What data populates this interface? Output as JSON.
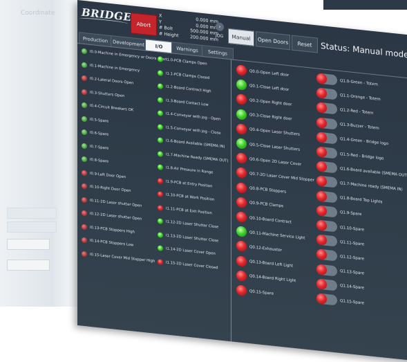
{
  "background": {
    "ghost_label": "Coordinate"
  },
  "header": {
    "logo": "BRIDGE",
    "abort": "Abort",
    "coords": [
      {
        "label": "X",
        "value": "0.000 mm"
      },
      {
        "label": "Y",
        "value": "0.000 mm"
      },
      {
        "label": "# Bolt",
        "value": "500.000 mm"
      },
      {
        "label": "# Height",
        "value": "200.000 mm"
      }
    ],
    "jog_arrow": "›",
    "jog_label": "JOG",
    "manual": "Manual",
    "open_doors": "Open Doors",
    "reset": "Reset",
    "status": "Status: Manual mode"
  },
  "tabs": [
    "Production",
    "Development",
    "I/O",
    "Warnings",
    "Settings"
  ],
  "active_tab": "I/O",
  "inputs_a": [
    {
      "label": "I0.0-Machine in Emergency or Doors open",
      "on": true
    },
    {
      "label": "I0.1-Machine in Emergency",
      "on": true
    },
    {
      "label": "I0.2-Lateral Doors Open",
      "on": false
    },
    {
      "label": "I0.3-Shutters Open",
      "on": false
    },
    {
      "label": "I0.4-Circuit Breakers OK",
      "on": true
    },
    {
      "label": "I0.5-Spare",
      "on": true
    },
    {
      "label": "I0.6-Spare",
      "on": true
    },
    {
      "label": "I0.7-Spare",
      "on": true
    },
    {
      "label": "I0.8-Spare",
      "on": true
    },
    {
      "label": "I0.9-Left Door Open",
      "on": false
    },
    {
      "label": "I0.10-Right Door Open",
      "on": false
    },
    {
      "label": "I0.11-2D Laser shutter Open",
      "on": false
    },
    {
      "label": "I0.12-2D Laser shutter Open",
      "on": false
    },
    {
      "label": "I0.13-PCB Stoppers High",
      "on": false
    },
    {
      "label": "I0.14-PCB Stoppers Low",
      "on": false
    },
    {
      "label": "I0.15-Laser Cover Mid Stopper High",
      "on": false
    }
  ],
  "inputs_b": [
    {
      "label": "I1.0-PCB Clamps Open",
      "on": true
    },
    {
      "label": "I1.1-PCB Clamps Closed",
      "on": true
    },
    {
      "label": "I1.2-Board Contract High",
      "on": true
    },
    {
      "label": "I1.3-Board Contact Low",
      "on": true
    },
    {
      "label": "I1.4-Conveyor with jog - Open",
      "on": true
    },
    {
      "label": "I1.5-Conveyor with jog - Close",
      "on": true
    },
    {
      "label": "I1.6-Board Available (SMEMA IN)",
      "on": true
    },
    {
      "label": "I1.7-Machine Ready (SMEMA OUT)",
      "on": true
    },
    {
      "label": "I1.8-Air Pressure in Range",
      "on": true
    },
    {
      "label": "I1.9-PCB at Entry Position",
      "on": false
    },
    {
      "label": "I1.10-PCB at Work Position",
      "on": false
    },
    {
      "label": "I1.11-PCB at Exit Position",
      "on": false
    },
    {
      "label": "I1.12-2D Laser Shutter Close",
      "on": true
    },
    {
      "label": "I1.13-2D Laser Shutter Close",
      "on": true
    },
    {
      "label": "I1.14-2D Laser Cover Open",
      "on": true
    },
    {
      "label": "I1.15-2D Laser Cover Closed",
      "on": false
    }
  ],
  "outputs_a": [
    {
      "label": "Q0.0-Open Left door",
      "on": false
    },
    {
      "label": "Q0.1-Close Left door",
      "on": true
    },
    {
      "label": "Q0.2-Open Right door",
      "on": false
    },
    {
      "label": "Q0.3-Close Right door",
      "on": true
    },
    {
      "label": "Q0.4-Open Laser Shutters",
      "on": false
    },
    {
      "label": "Q0.5-Close Laser Shutters",
      "on": true
    },
    {
      "label": "Q0.6-Open 2D Laser Cover",
      "on": false
    },
    {
      "label": "Q0.7-2D Laser Cover Mid Stopper",
      "on": false
    },
    {
      "label": "Q0.8-PCB Stoppers",
      "on": false
    },
    {
      "label": "Q0.9-PCB Clamps",
      "on": false
    },
    {
      "label": "Q0.10-Board Contract",
      "on": false
    },
    {
      "label": "Q0.11-Machine Service Light",
      "on": true
    },
    {
      "label": "Q0.12-Exhauster",
      "on": false
    },
    {
      "label": "Q0.13-Board Left Light",
      "on": false
    },
    {
      "label": "Q0.14-Board Right Light",
      "on": false
    },
    {
      "label": "Q0.15-Spare",
      "on": false
    }
  ],
  "outputs_b": [
    {
      "label": "Q1.0-Green - Totem",
      "on": false
    },
    {
      "label": "Q1.1-Orange - Totem",
      "on": false
    },
    {
      "label": "Q1.2-Red - Totem",
      "on": false
    },
    {
      "label": "Q1.3-Buzzer - Totem",
      "on": false
    },
    {
      "label": "Q1.4-Green - Bridge logo",
      "on": false
    },
    {
      "label": "Q1.5-Red - Bridge logo",
      "on": false
    },
    {
      "label": "Q1.6-Board available (SMEMA OUT)",
      "on": false
    },
    {
      "label": "Q1.7-Machine ready (SMEMA IN)",
      "on": false
    },
    {
      "label": "Q1.8-Board Top Lights",
      "on": false
    },
    {
      "label": "Q1.9-Spare",
      "on": false
    },
    {
      "label": "Q1.10-Spare",
      "on": false
    },
    {
      "label": "Q1.11-Spare",
      "on": false
    },
    {
      "label": "Q1.12-Spare",
      "on": false
    },
    {
      "label": "Q1.13-Spare",
      "on": false
    },
    {
      "label": "Q1.14-Spare",
      "on": false
    },
    {
      "label": "Q1.15-Spare",
      "on": false
    }
  ],
  "colors": {
    "panel": "#2e3b48",
    "led_on": "#3fd12a",
    "led_off": "#e2262c",
    "abort": "#c4242a"
  }
}
